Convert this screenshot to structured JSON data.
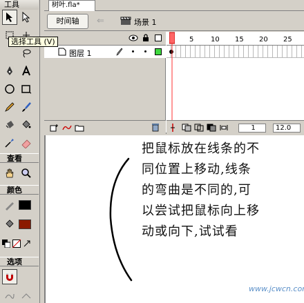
{
  "toolbar": {
    "title": "工具",
    "tooltip": "选择工具 (V)",
    "sections": {
      "view": "查看",
      "colors": "颜色",
      "options": "选项"
    },
    "stroke_color": "#000000",
    "fill_color": "#8b1a00"
  },
  "document": {
    "tab_label": "树叶.fla*"
  },
  "timeline": {
    "button_label": "时间轴",
    "scene_label": "场景 1",
    "layer_name": "图层 1",
    "ruler_numbers": [
      "1",
      "5",
      "10",
      "15",
      "20",
      "25"
    ],
    "current_frame": "1",
    "frame_rate": "12.0"
  },
  "stage": {
    "note_lines": [
      "把鼠标放在线条的不",
      "同位置上移动,线条",
      "的弯曲是不同的,可",
      "以尝试把鼠标向上移",
      "动或向下,试试看"
    ],
    "watermark": "www.jcwcn.com"
  }
}
